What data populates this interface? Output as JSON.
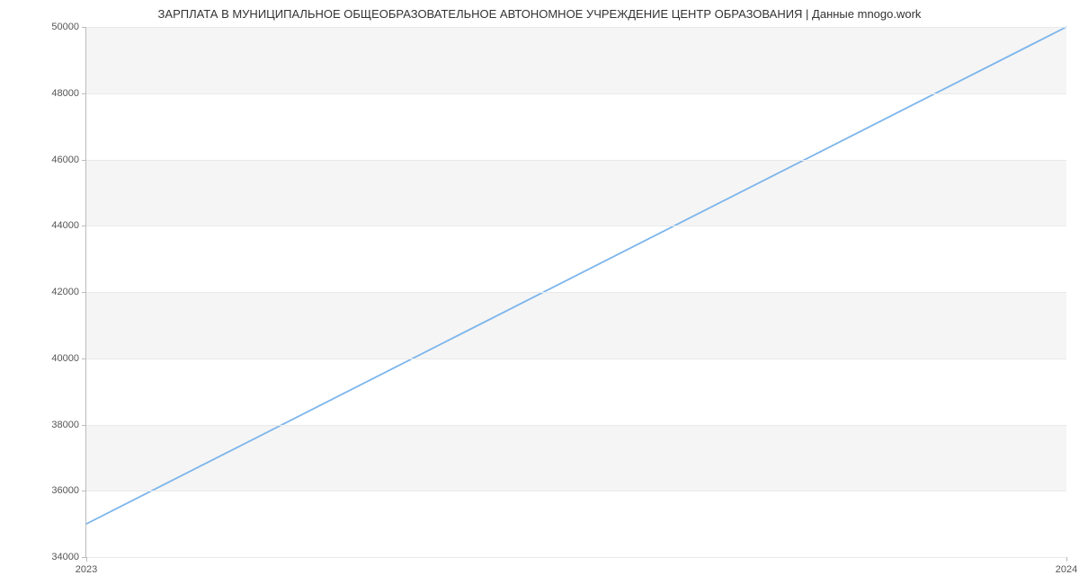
{
  "chart_data": {
    "type": "line",
    "title": "ЗАРПЛАТА В МУНИЦИПАЛЬНОЕ ОБЩЕОБРАЗОВАТЕЛЬНОЕ АВТОНОМНОЕ УЧРЕЖДЕНИЕ ЦЕНТР ОБРАЗОВАНИЯ | Данные mnogo.work",
    "x": [
      2023,
      2024
    ],
    "y": [
      35000,
      50000
    ],
    "xlim": [
      2023,
      2024
    ],
    "ylim": [
      34000,
      50000
    ],
    "yticks": [
      34000,
      36000,
      38000,
      40000,
      42000,
      44000,
      46000,
      48000,
      50000
    ],
    "xticks": [
      2023,
      2024
    ],
    "line_color": "#7cb5ec",
    "band_color": "#f5f5f5"
  }
}
